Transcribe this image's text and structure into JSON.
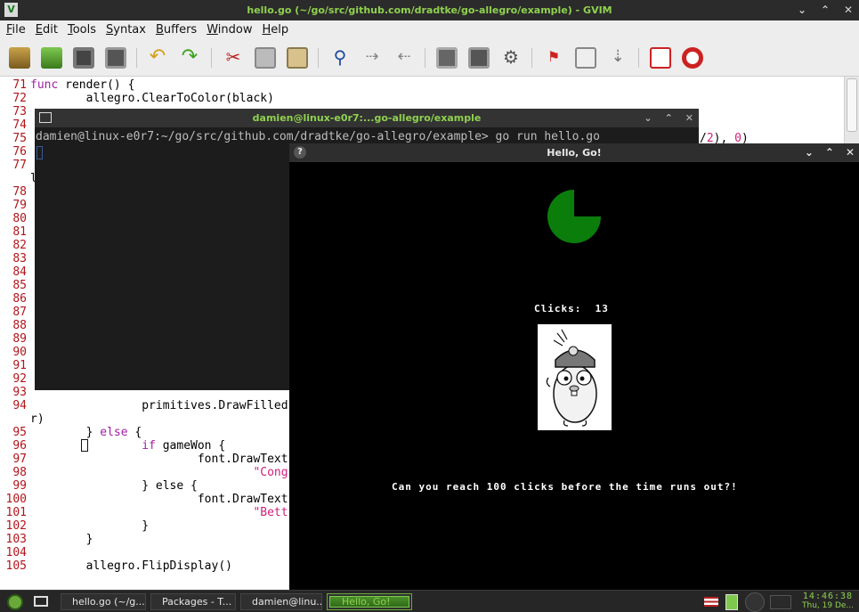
{
  "gvim": {
    "title": "hello.go (~/go/src/github.com/dradtke/go-allegro/example) - GVIM",
    "icon": "vim-icon",
    "menu": [
      "File",
      "Edit",
      "Tools",
      "Syntax",
      "Buffers",
      "Window",
      "Help"
    ],
    "toolbar_icons": [
      "open-icon",
      "save-download-icon",
      "save-icon",
      "print-icon",
      "undo-icon",
      "redo-icon",
      "cut-icon",
      "copy-icon",
      "paste-icon",
      "find-replace-icon",
      "find-next-icon",
      "find-prev-icon",
      "load-session-icon",
      "save-session-icon",
      "run-script-icon",
      "make-icon",
      "build-tags-icon",
      "jump-tag-icon",
      "help-icon",
      "find-help-icon"
    ]
  },
  "code": {
    "l71": {
      "n": "71",
      "kw": "func",
      "rest": " render() {"
    },
    "l72": {
      "n": "72",
      "text": "        allegro.ClearToColor(black)"
    },
    "l73": {
      "n": "73"
    },
    "l74": {
      "n": "74"
    },
    "l75": {
      "n": "75",
      "tail_open": "/",
      "tail_num1": "2",
      "tail_mid": "), ",
      "tail_num2": "0",
      "tail_close": ")"
    },
    "l76": {
      "n": "76"
    },
    "l77": {
      "n": "77"
    },
    "l77b": {
      "text": "l"
    },
    "l78": {
      "n": "78"
    },
    "l79": {
      "n": "79"
    },
    "l80": {
      "n": "80"
    },
    "l81": {
      "n": "81"
    },
    "l82": {
      "n": "82"
    },
    "l83": {
      "n": "83"
    },
    "l84": {
      "n": "84"
    },
    "l85": {
      "n": "85"
    },
    "l86": {
      "n": "86"
    },
    "l87": {
      "n": "87"
    },
    "l88": {
      "n": "88"
    },
    "l89": {
      "n": "89"
    },
    "l90": {
      "n": "90"
    },
    "l91": {
      "n": "91"
    },
    "l92": {
      "n": "92"
    },
    "l93": {
      "n": "93"
    },
    "l94": {
      "n": "94",
      "text": "                primitives.DrawFilled"
    },
    "l94b": {
      "text": "r)"
    },
    "l95": {
      "n": "95",
      "pre": "        } ",
      "kw": "else",
      "post": " {"
    },
    "l96": {
      "n": "96",
      "pre": "                ",
      "kw": "if",
      "post": " gameWon {"
    },
    "l97": {
      "n": "97",
      "text": "                        font.DrawText"
    },
    "l98": {
      "n": "98",
      "pre": "                                ",
      "str": "\"Cong"
    },
    "l99": {
      "n": "99",
      "text": "                } else {"
    },
    "l100": {
      "n": "100",
      "text": "                        font.DrawText"
    },
    "l101": {
      "n": "101",
      "pre": "                                ",
      "str": "\"Bett"
    },
    "l102": {
      "n": "102",
      "text": "                }"
    },
    "l103": {
      "n": "103",
      "text": "        }"
    },
    "l104": {
      "n": "104"
    },
    "l105": {
      "n": "105",
      "text": "        allegro.FlipDisplay()"
    }
  },
  "terminal": {
    "title": "damien@linux-e0r7:...go-allegro/example",
    "prompt": "damien@linux-e0r7:~/go/src/github.com/dradtke/go-allegro/example> go run hello.go"
  },
  "allegro": {
    "title": "Hello, Go!",
    "help_glyph": "?",
    "clicks_label": "Clicks:",
    "clicks_value": "13",
    "message": "Can you reach 100 clicks before the time runs out?!",
    "timer_fraction_remaining": 0.75,
    "timer_color": "#0b7d0b"
  },
  "taskbar": {
    "tasks": [
      "hello.go (~/g...",
      "Packages - T...",
      "damien@linu...",
      "Hello, Go!"
    ],
    "clock_time": "14:46:38",
    "clock_date": "Thu, 19 De..."
  },
  "colors": {
    "accent_green": "#8fd14f",
    "line_number": "#b0151b",
    "keyword": "#a11fa1"
  }
}
